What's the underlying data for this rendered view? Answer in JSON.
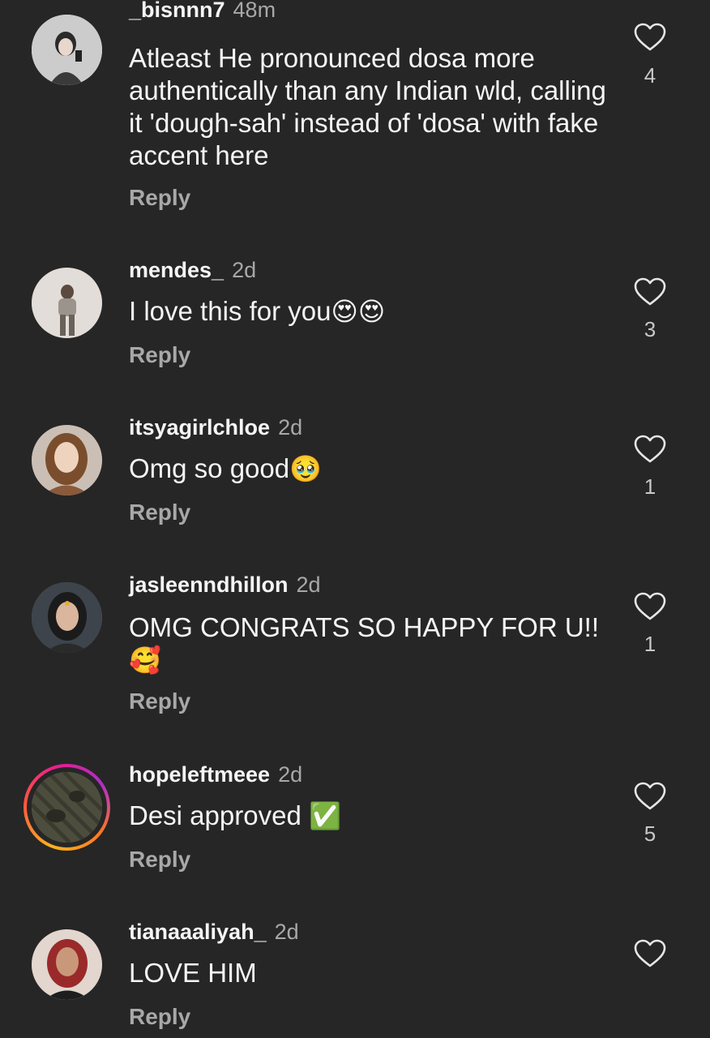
{
  "comments": [
    {
      "username": "_bisnnn7",
      "time": "48m",
      "text": "Atleast He pronounced dosa more authentically than any Indian wld, calling it 'dough-sah' instead of 'dosa' with fake accent here",
      "emoji": "",
      "reply_label": "Reply",
      "likes": "4",
      "avatar_colors": [
        "#cfcfcf",
        "#2a2a2a"
      ]
    },
    {
      "username": "mendes_",
      "time": "2d",
      "text": "I love this for you",
      "emoji": "😍😍",
      "reply_label": "Reply",
      "likes": "3",
      "avatar_colors": [
        "#d9d4cf",
        "#7a746d"
      ]
    },
    {
      "username": "itsyagirlchloe",
      "time": "2d",
      "text": "Omg so good",
      "emoji": "🥹",
      "reply_label": "Reply",
      "likes": "1",
      "avatar_colors": [
        "#e3c9b5",
        "#8a5a3a"
      ]
    },
    {
      "username": "jasleenndhillon",
      "time": "2d",
      "text": "OMG CONGRATS SO HAPPY FOR U!!",
      "emoji": "🥰",
      "reply_label": "Reply",
      "likes": "1",
      "avatar_colors": [
        "#4a5158",
        "#1d1f22"
      ]
    },
    {
      "username": "hopeleftmeee",
      "time": "2d",
      "text": "Desi approved",
      "emoji": "✅",
      "reply_label": "Reply",
      "likes": "5",
      "avatar_colors": [
        "#5a5a48",
        "#2d2d24"
      ]
    },
    {
      "username": "tianaaaliyah_",
      "time": "2d",
      "text": "LOVE HIM",
      "emoji": "",
      "reply_label": "Reply",
      "likes": "",
      "avatar_colors": [
        "#d6c8c0",
        "#9a2a2a"
      ]
    }
  ],
  "icons": {
    "like": "heart-outline-icon"
  },
  "colors": {
    "background": "#262626",
    "text_primary": "#f5f5f5",
    "text_secondary": "#a8a8a8"
  }
}
